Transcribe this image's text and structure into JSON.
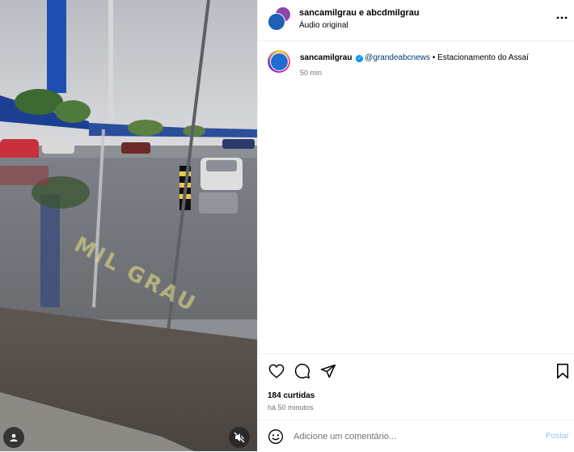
{
  "media": {
    "watermark": "MIL GRAU",
    "icons": {
      "user": "user-icon",
      "mute": "mute-icon"
    }
  },
  "header": {
    "user1": "sancamilgrau",
    "joiner": "e",
    "user2": "abcdmilgrau",
    "audio": "Áudio original",
    "more_icon": "more-icon"
  },
  "caption": {
    "username": "sancamilgrau",
    "mention": "@grandeabcnews",
    "text": "• Estacionamento do Assaí",
    "time": "50 min"
  },
  "actions": {
    "icons": [
      "heart-icon",
      "comment-icon",
      "share-icon",
      "bookmark-icon"
    ],
    "likes": "184 curtidas",
    "posted": "há 50 minutos"
  },
  "comment": {
    "placeholder": "Adicione um comentário...",
    "post_label": "Postar",
    "post_color": "#8cc8f5"
  }
}
